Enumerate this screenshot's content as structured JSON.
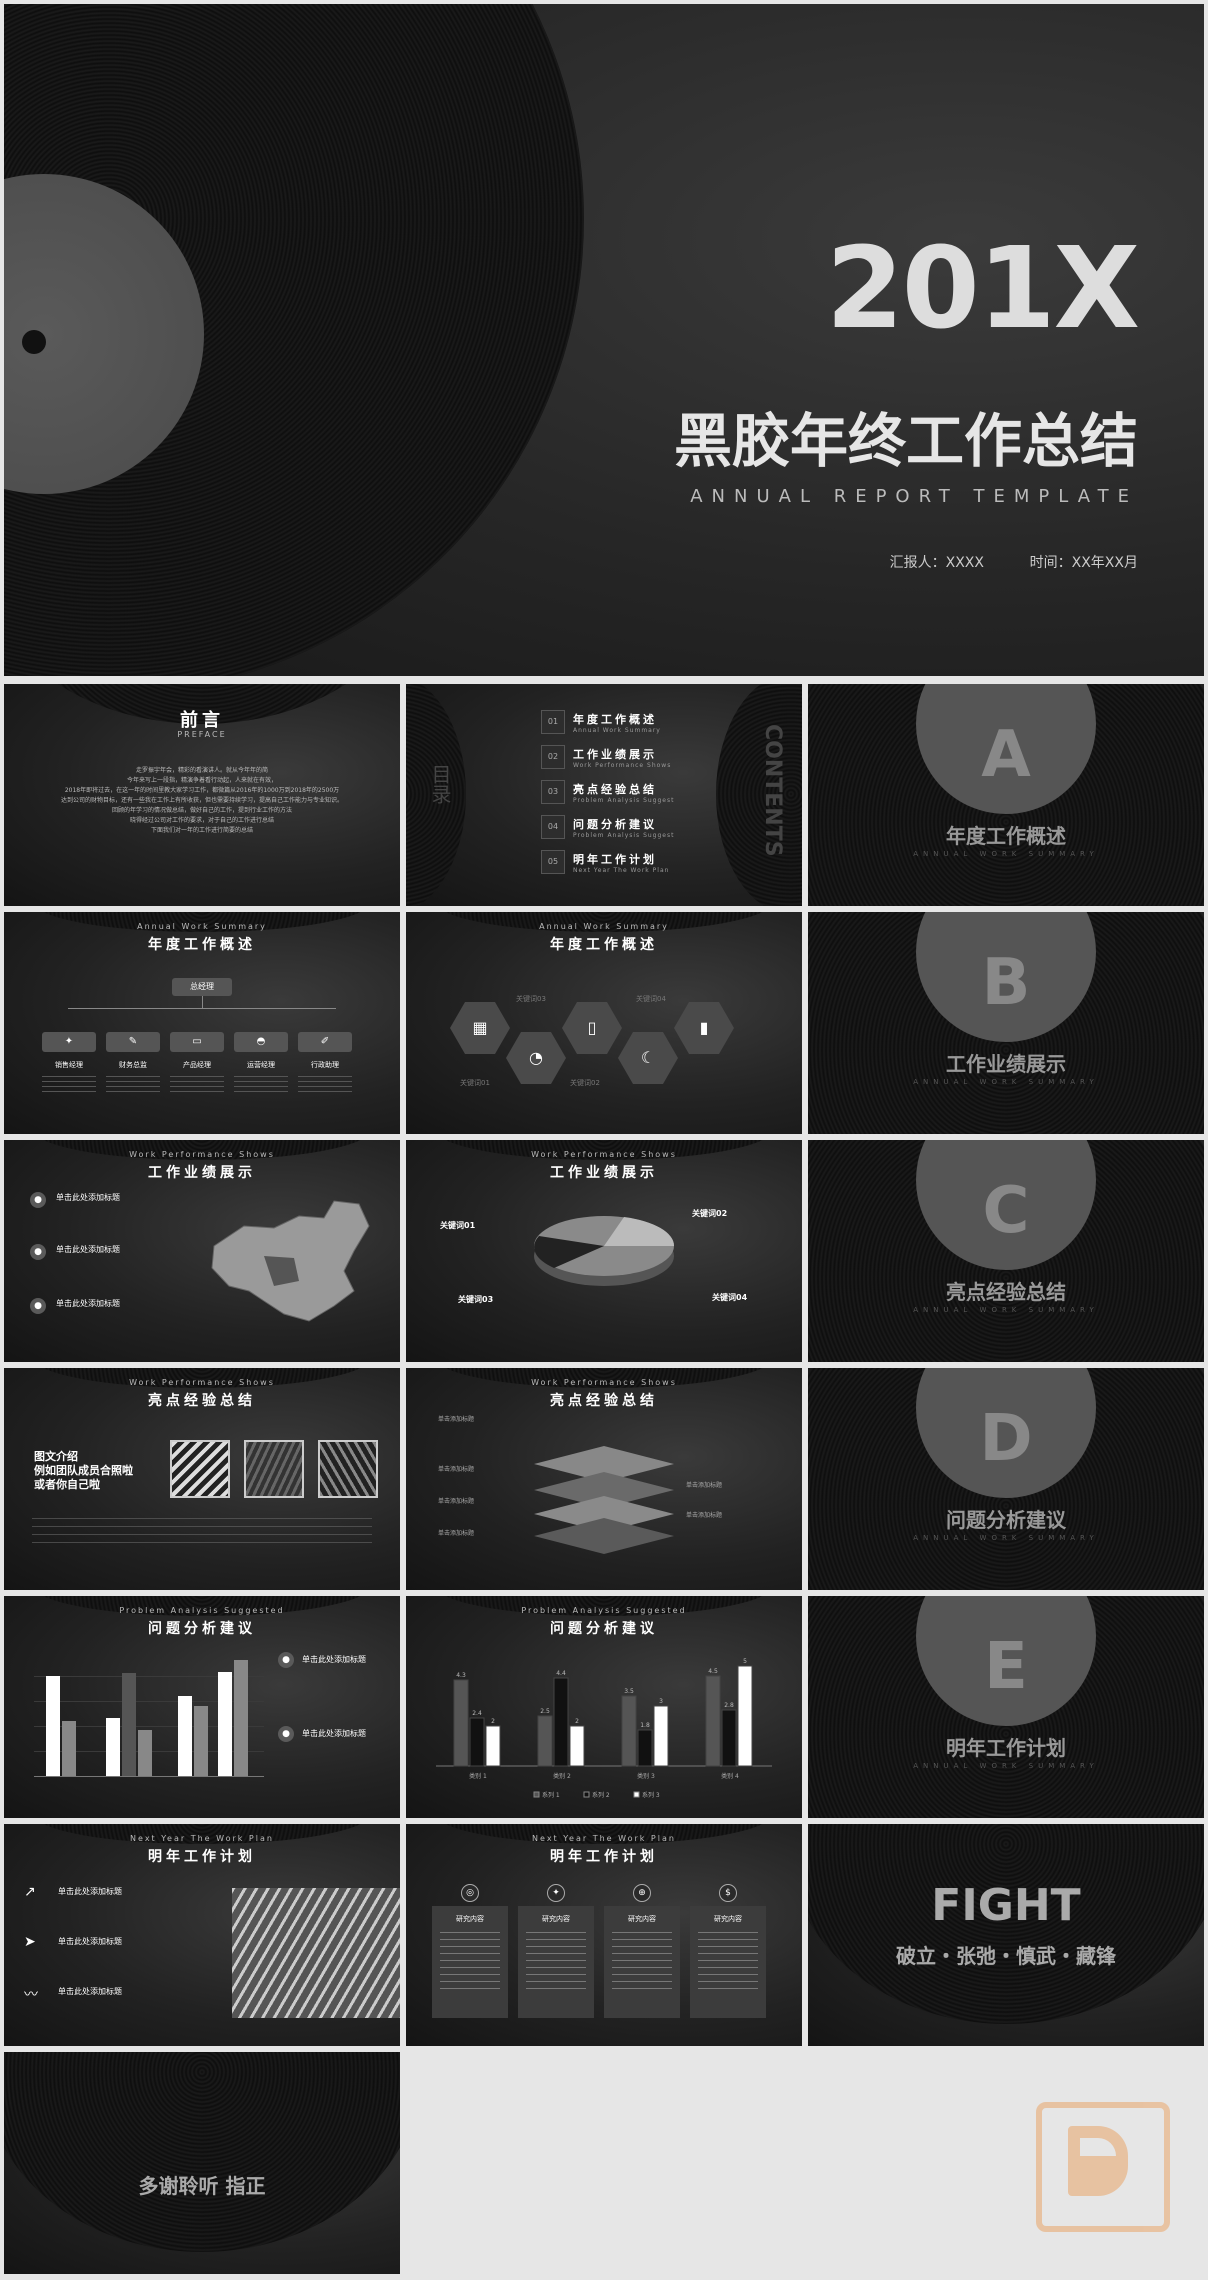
{
  "cover": {
    "year": "201X",
    "title": "黑胶年终工作总结",
    "subtitle": "ANNUAL REPORT TEMPLATE",
    "reporter": "汇报人：XXXX",
    "time": "时间：XX年XX月"
  },
  "preface": {
    "title": "前言",
    "en": "PREFACE",
    "lines": [
      "走罗振宇年会，精彩的看演讲人。就从今年年的简",
      "今年来写上一段指，精演争着看行动起，人来就在有效，",
      "2018年即将过去，在这一年的时间里教大家学习工作，都微篇从2016年的1000万到2018年的2500万",
      "达到公司的财物目标，还有一些我在工作上有所收获，但也需要持续学习，提高自己工作能力与专业知识。",
      "回顾的年学习的情况做总结，做好自己的工作，提到行业工作的方法",
      "晓得经过公司对工作的要求，对于自己的工作进行总结",
      "下面我们对一年的工作进行简要的总结"
    ]
  },
  "contents": {
    "cn_side": "目录",
    "en_side": "CONTENTS",
    "items": [
      {
        "num": "01",
        "cn": "年度工作概述",
        "en": "Annual Work Summary"
      },
      {
        "num": "02",
        "cn": "工作业绩展示",
        "en": "Work Performance Shows"
      },
      {
        "num": "03",
        "cn": "亮点经验总结",
        "en": "Problem Analysis Suggest"
      },
      {
        "num": "04",
        "cn": "问题分析建议",
        "en": "Problem Analysis Suggest"
      },
      {
        "num": "05",
        "cn": "明年工作计划",
        "en": "Next Year The Work Plan"
      }
    ]
  },
  "sections": [
    {
      "letter": "A",
      "cn": "年度工作概述",
      "en": "ANNUAL WORK SUMMARY"
    },
    {
      "letter": "B",
      "cn": "工作业绩展示",
      "en": "ANNUAL WORK SUMMARY"
    },
    {
      "letter": "C",
      "cn": "亮点经验总结",
      "en": "ANNUAL WORK SUMMARY"
    },
    {
      "letter": "D",
      "cn": "问题分析建议",
      "en": "ANNUAL WORK SUMMARY"
    },
    {
      "letter": "E",
      "cn": "明年工作计划",
      "en": "ANNUAL WORK SUMMARY"
    }
  ],
  "s_org": {
    "en": "Annual Work Summary",
    "cn": "年度工作概述",
    "root": "总经理",
    "nodes": [
      "销售经理",
      "财务总监",
      "产品经理",
      "运营经理",
      "行政助理"
    ]
  },
  "s_hex": {
    "en": "Annual Work Summary",
    "cn": "年度工作概述",
    "keys": [
      "关键词01",
      "关键词02",
      "关键词03",
      "关键词04"
    ]
  },
  "s_map": {
    "en": "Work Performance Shows",
    "cn": "工作业绩展示",
    "items": [
      "单击此处添加标题",
      "单击此处添加标题",
      "单击此处添加标题"
    ]
  },
  "s_pie": {
    "en": "Work Performance Shows",
    "cn": "工作业绩展示",
    "keys": [
      "关键词01",
      "关键词02",
      "关键词03",
      "关键词04"
    ]
  },
  "s_img": {
    "en": "Work Performance Shows",
    "cn": "亮点经验总结",
    "intro": [
      "图文介绍",
      "例如团队成员合照啦",
      "或者你自己啦"
    ]
  },
  "s_layer": {
    "en": "Work Performance Shows",
    "cn": "亮点经验总结",
    "labels": [
      "单击添加标题",
      "单击添加标题",
      "单击添加标题",
      "单击添加标题",
      "单击添加标题",
      "单击添加标题"
    ]
  },
  "s_bar1": {
    "en": "Problem Analysis Suggested",
    "cn": "问题分析建议",
    "items": [
      "单击此处添加标题",
      "单击此处添加标题"
    ]
  },
  "chart_data": {
    "type": "bar",
    "categories": [
      "类别 1",
      "类别 2",
      "类别 3",
      "类别 4"
    ],
    "series": [
      {
        "name": "系列 1",
        "values": [
          4.3,
          2.5,
          3.5,
          4.5
        ]
      },
      {
        "name": "系列 2",
        "values": [
          2.4,
          4.4,
          1.8,
          2.8
        ]
      },
      {
        "name": "系列 3",
        "values": [
          2,
          2,
          3,
          5
        ]
      }
    ],
    "ylim": [
      0,
      5
    ]
  },
  "s_bar2": {
    "en": "Problem Analysis Suggested",
    "cn": "问题分析建议"
  },
  "s_plan1": {
    "en": "Next Year The Work Plan",
    "cn": "明年工作计划",
    "items": [
      "单击此处添加标题",
      "单击此处添加标题",
      "单击此处添加标题"
    ]
  },
  "s_plan2": {
    "en": "Next Year The Work Plan",
    "cn": "明年工作计划",
    "cards": [
      "研究内容",
      "研究内容",
      "研究内容",
      "研究内容"
    ]
  },
  "fight": {
    "title": "FIGHT",
    "motto": "破立・张弛・慎武・藏锋"
  },
  "thanks": {
    "text": "多谢聆听 指正"
  },
  "colors": {
    "accent": "#e8c15a",
    "watermark": "#e9a66a"
  }
}
